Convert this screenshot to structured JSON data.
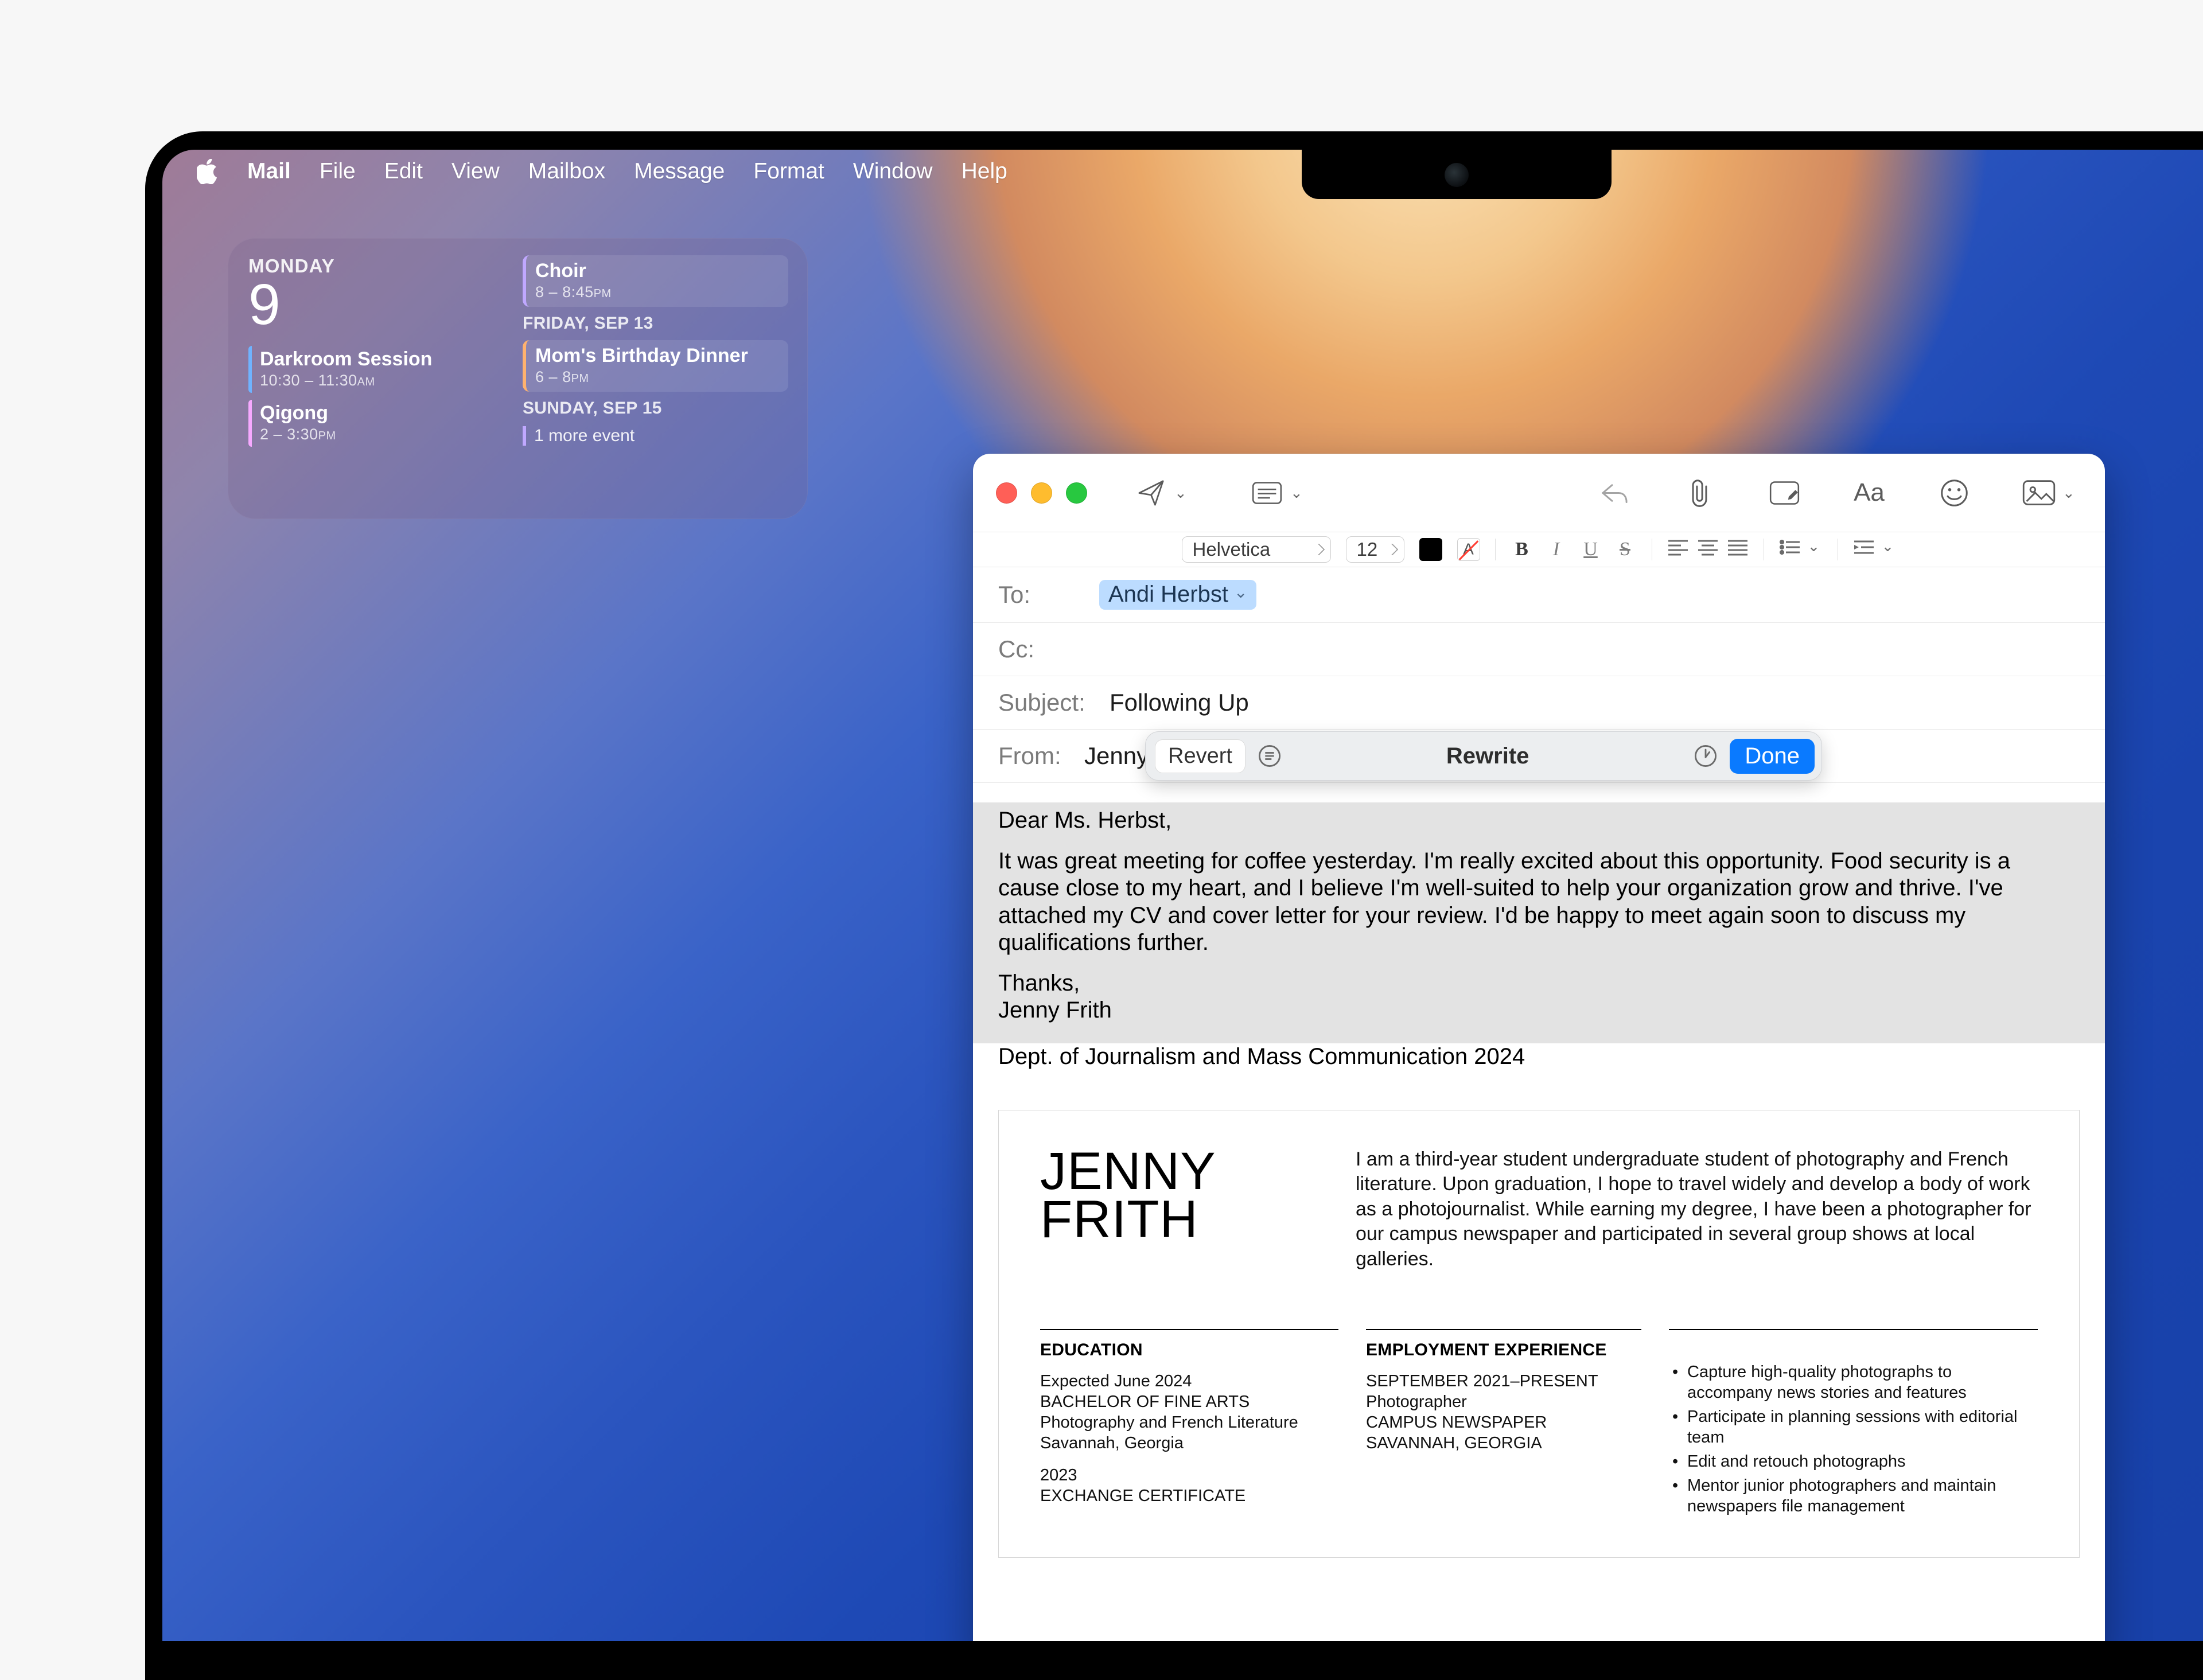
{
  "menubar": {
    "app": "Mail",
    "items": [
      "File",
      "Edit",
      "View",
      "Mailbox",
      "Message",
      "Format",
      "Window",
      "Help"
    ]
  },
  "widget": {
    "weekday": "MONDAY",
    "day": "9",
    "left_events": [
      {
        "title": "Darkroom Session",
        "time_a": "10:30",
        "time_b": "11:30",
        "ampm": "AM",
        "color": "blue"
      },
      {
        "title": "Qigong",
        "time_a": "2",
        "time_b": "3:30",
        "ampm": "PM",
        "color": "purple"
      }
    ],
    "right": [
      {
        "type": "event",
        "title": "Choir",
        "time_a": "8",
        "time_b": "8:45",
        "ampm": "PM",
        "color": "lav",
        "bg": true
      },
      {
        "type": "head",
        "label": "FRIDAY, SEP 13"
      },
      {
        "type": "event",
        "title": "Mom's Birthday Dinner",
        "time_a": "6",
        "time_b": "8",
        "ampm": "PM",
        "color": "orange",
        "bg": true
      },
      {
        "type": "head",
        "label": "SUNDAY, SEP 15"
      },
      {
        "type": "link",
        "label": "1 more event"
      }
    ]
  },
  "compose": {
    "format": {
      "font": "Helvetica",
      "size": "12"
    },
    "to_label": "To:",
    "to_pill": "Andi Herbst",
    "cc_label": "Cc:",
    "subject_label": "Subject:",
    "subject": "Following Up",
    "from_label": "From:",
    "from_value": "Jenny Frith"
  },
  "ai": {
    "revert": "Revert",
    "title": "Rewrite",
    "done": "Done"
  },
  "body": {
    "greeting": "Dear Ms. Herbst,",
    "para": "It was great meeting for coffee yesterday. I'm really excited about this opportunity. Food security is a cause close to my heart, and I believe I'm well-suited to help your organization grow and thrive. I've attached my CV and cover letter for your review. I'd be happy to meet again soon to discuss my qualifications further.",
    "thanks": "Thanks,",
    "sig1": "Jenny Frith",
    "sig2": "Dept. of Journalism and Mass Communication 2024"
  },
  "resume": {
    "name1": "JENNY",
    "name2": "FRITH",
    "bio": "I am a third-year student undergraduate student of photography and French literature. Upon graduation, I hope to travel widely and develop a body of work as a photojournalist. While earning my degree, I have been a photographer for our campus newspaper and participated in several group shows at local galleries.",
    "edu_h": "EDUCATION",
    "edu1": "Expected June 2024\nBACHELOR OF FINE ARTS\nPhotography and French Literature\nSavannah, Georgia",
    "edu2": "2023\nEXCHANGE CERTIFICATE",
    "emp_h": "EMPLOYMENT EXPERIENCE",
    "emp1": "SEPTEMBER 2021–PRESENT\n    Photographer\nCAMPUS NEWSPAPER\nSAVANNAH, GEORGIA",
    "bullets": [
      "Capture high-quality photographs to accompany news stories and features",
      "Participate in planning sessions with editorial team",
      "Edit and retouch photographs",
      "Mentor junior photographers and maintain newspapers file management"
    ]
  }
}
